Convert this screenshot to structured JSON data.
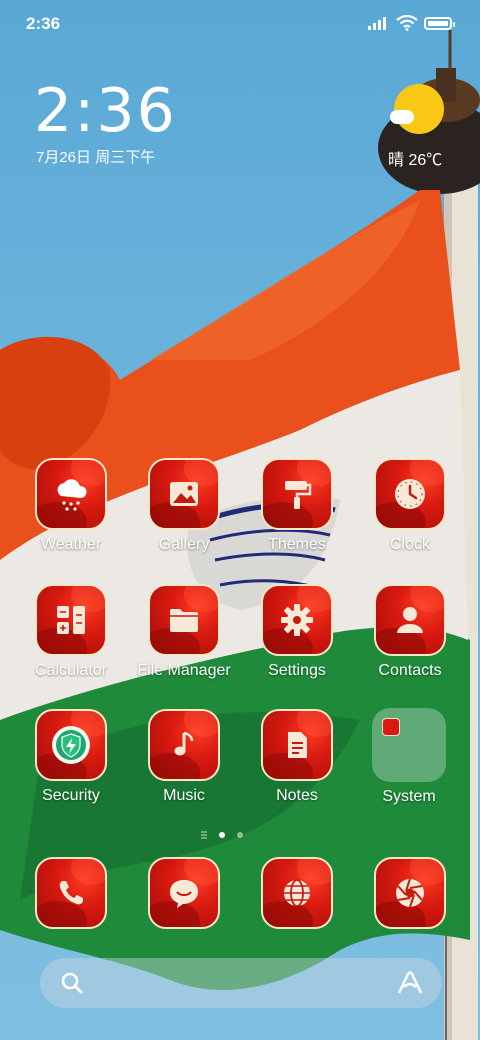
{
  "status_bar": {
    "time": "2:36"
  },
  "lockclock": {
    "time": "2:36",
    "date": "7月26日 周三下午"
  },
  "weather": {
    "text": "晴 26℃",
    "icon": "sunny-cloud-icon"
  },
  "apps": [
    {
      "label": "Weather",
      "icon": "cloud-snow-icon"
    },
    {
      "label": "Gallery",
      "icon": "image-icon"
    },
    {
      "label": "Themes",
      "icon": "paint-roller-icon"
    },
    {
      "label": "Clock",
      "icon": "clock-icon"
    },
    {
      "label": "Calculator",
      "icon": "calculator-icon"
    },
    {
      "label": "File Manager",
      "icon": "folder-icon"
    },
    {
      "label": "Settings",
      "icon": "gear-icon"
    },
    {
      "label": "Contacts",
      "icon": "person-icon"
    },
    {
      "label": "Security",
      "icon": "shield-bolt-icon"
    },
    {
      "label": "Music",
      "icon": "music-note-icon"
    },
    {
      "label": "Notes",
      "icon": "note-icon"
    },
    {
      "label": "System",
      "icon": "folder-icon"
    }
  ],
  "dock": [
    {
      "icon": "phone-icon"
    },
    {
      "icon": "message-icon"
    },
    {
      "icon": "globe-icon"
    },
    {
      "icon": "camera-aperture-icon"
    }
  ],
  "page_indicator": {
    "pages": 2,
    "current": 1
  },
  "colors": {
    "icon_red": "#d81a10",
    "icon_border": "#f4e6c8",
    "sun": "#f8c814",
    "sky": "#6cb4dc"
  }
}
